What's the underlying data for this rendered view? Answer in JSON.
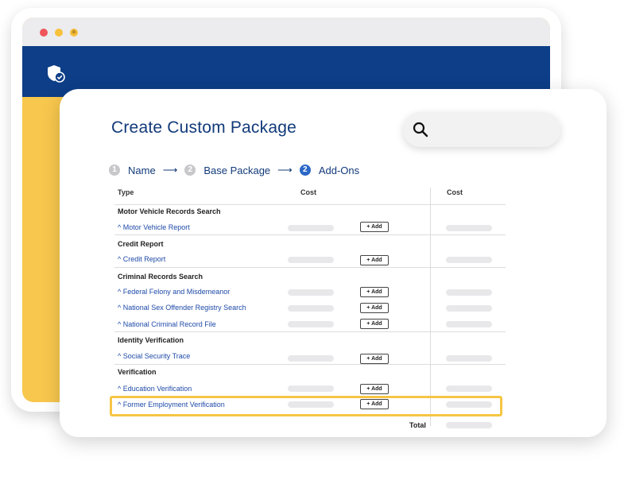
{
  "colors": {
    "brand_blue": "#0d3e87",
    "accent_yellow": "#f8c74d",
    "link_blue": "#1f4aa8",
    "highlight": "#f6c544"
  },
  "icons": {
    "logo": "shield-check-icon",
    "search": "search-icon"
  },
  "title": "Create Custom Package",
  "steps": [
    {
      "num": "1",
      "label": "Name"
    },
    {
      "num": "2",
      "label": "Base Package"
    },
    {
      "num": "2",
      "label": "Add-Ons"
    }
  ],
  "table": {
    "col_type": "Type",
    "col_cost": "Cost",
    "col_cost2": "Cost",
    "add_label": "+ Add",
    "total_label": "Total",
    "sections": [
      {
        "title": "Motor Vehicle Records Search",
        "items": [
          "^ Motor Vehicle Report"
        ]
      },
      {
        "title": "Credit Report",
        "items": [
          "^ Credit Report"
        ]
      },
      {
        "title": "Criminal Records Search",
        "items": [
          "^ Federal Felony and Misdemeanor",
          "^ National Sex Offender Registry Search",
          "^ National Criminal Record File"
        ]
      },
      {
        "title": "Identity Verification",
        "items": [
          "^ Social Security Trace"
        ]
      },
      {
        "title": "Verification",
        "items": [
          "^ Education Verification",
          "^ Former Employment Verification"
        ]
      }
    ]
  }
}
